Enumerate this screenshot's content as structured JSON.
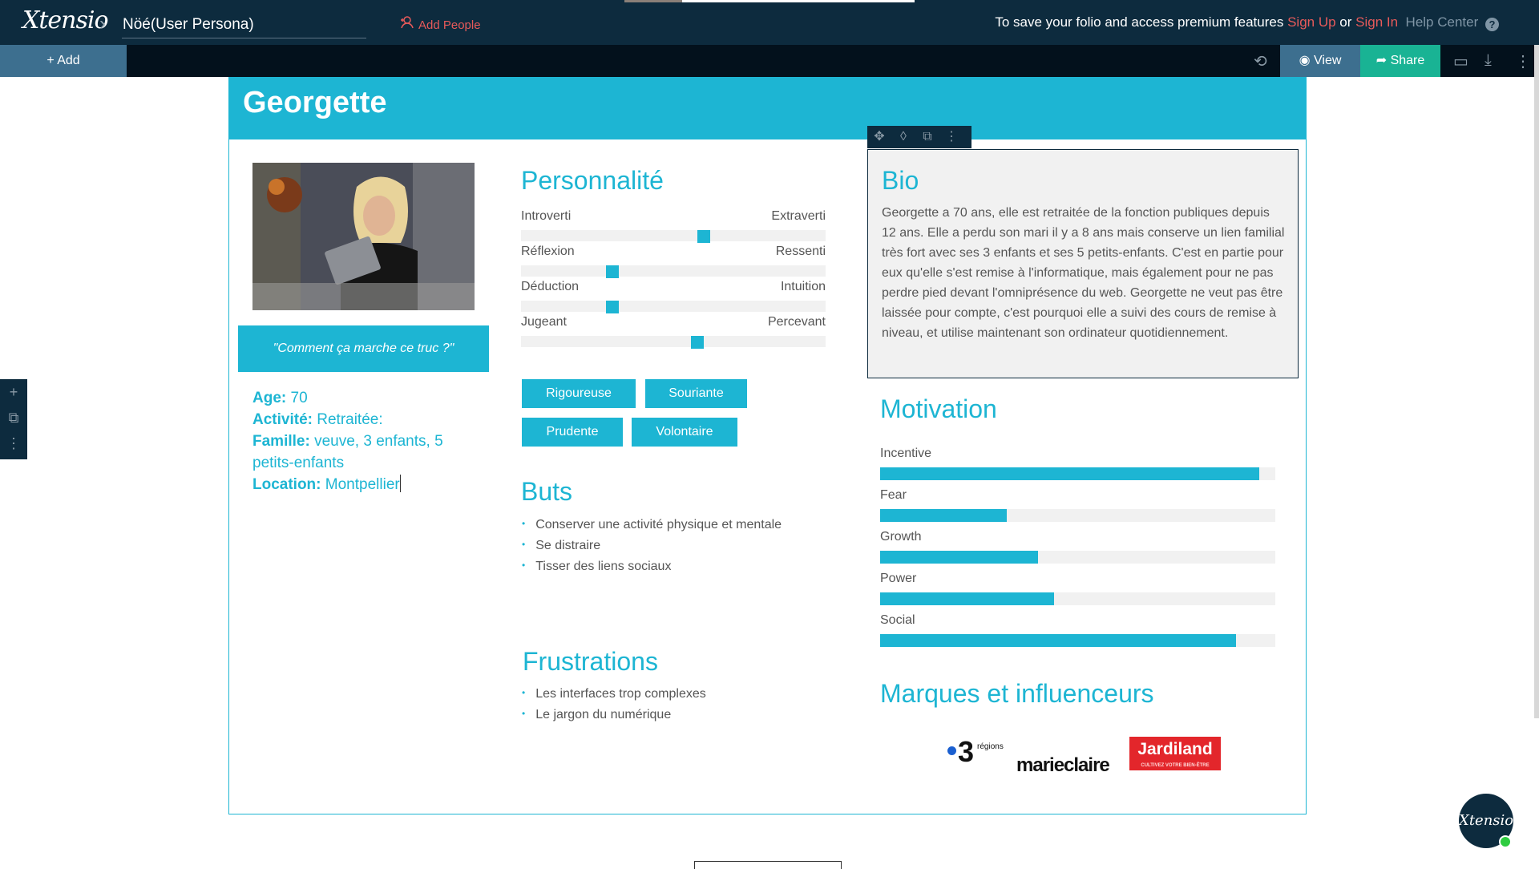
{
  "header": {
    "logo_text": "Xtensio",
    "project_name": "Nöé(User Persona)",
    "add_people_label": "Add People",
    "save_message": "To save your folio and access premium features",
    "sign_up_label": "Sign Up",
    "or_label": "or",
    "sign_in_label": "Sign In",
    "help_center_label": "Help Center"
  },
  "toolbar": {
    "add_label": "+ Add",
    "view_label": "View",
    "share_label": "Share"
  },
  "persona": {
    "name": "Georgette",
    "quote": "\"Comment ça marche ce truc ?\"",
    "facts": [
      {
        "label": "Age:",
        "value": "70"
      },
      {
        "label": "Activité:",
        "value": "Retraitée:"
      },
      {
        "label": "Famille:",
        "value": "veuve, 3 enfants, 5 petits-enfants"
      },
      {
        "label": "Location:",
        "value": "Montpellier"
      }
    ]
  },
  "personality": {
    "title": "Personnalité",
    "sliders": [
      {
        "left": "Introverti",
        "right": "Extraverti",
        "value": 0.6
      },
      {
        "left": "Réflexion",
        "right": "Ressenti",
        "value": 0.3
      },
      {
        "left": "Déduction",
        "right": "Intuition",
        "value": 0.3
      },
      {
        "left": "Jugeant",
        "right": "Percevant",
        "value": 0.58
      }
    ],
    "tags": [
      "Rigoureuse",
      "Souriante",
      "Prudente",
      "Volontaire"
    ]
  },
  "goals": {
    "title": "Buts",
    "items": [
      "Conserver une activité physique et mentale",
      "Se distraire",
      "Tisser des liens sociaux"
    ]
  },
  "frustrations": {
    "title": "Frustrations",
    "items": [
      "Les interfaces trop complexes",
      "Le jargon du numérique"
    ]
  },
  "bio": {
    "title": "Bio",
    "text": "Georgette a 70 ans, elle est retraitée de la fonction publiques depuis 12 ans. Elle a perdu son mari il y a 8 ans mais conserve un lien familial très fort avec ses 3 enfants et ses 5 petits-enfants. C'est en partie pour eux qu'elle s'est remise à l'informatique, mais également pour ne pas perdre pied devant l'omniprésence du web. Georgette ne veut pas être laissée pour compte, c'est pourquoi elle a suivi des cours de remise à niveau, et utilise maintenant son ordinateur quotidiennement."
  },
  "motivation": {
    "title": "Motivation",
    "bars": [
      {
        "label": "Incentive",
        "value": 0.96
      },
      {
        "label": "Fear",
        "value": 0.32
      },
      {
        "label": "Growth",
        "value": 0.4
      },
      {
        "label": "Power",
        "value": 0.44
      },
      {
        "label": "Social",
        "value": 0.9
      }
    ]
  },
  "brands": {
    "title": "Marques et influenceurs",
    "france3": "3",
    "france3_sub": "régions",
    "marieclaire": "marieclaire",
    "jardiland": "Jardiland",
    "jardiland_tagline": "CULTIVEZ VOTRE BIEN-ÊTRE"
  },
  "chat": {
    "label": "Xtensio"
  },
  "colors": {
    "accent": "#1db5d3",
    "navy": "#0d2b3e",
    "share": "#19b394",
    "link_red": "#e75a5a"
  }
}
